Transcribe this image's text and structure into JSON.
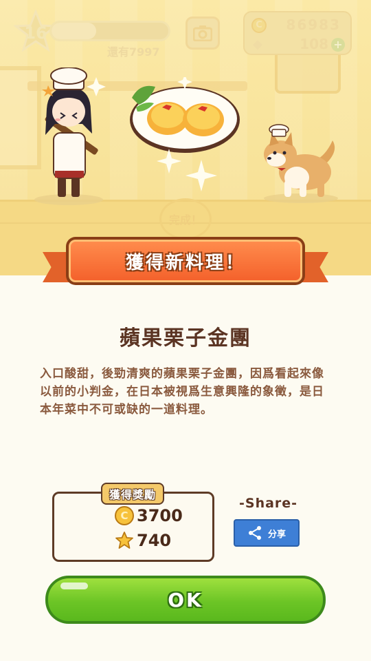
{
  "hud": {
    "level": "16",
    "exp_remaining_text": "還有7997",
    "exp_progress": 0.38,
    "coins": "86983",
    "gems": "108",
    "coin_symbol": "C",
    "plus_symbol": "+"
  },
  "scene": {
    "complete_stamp": "完成！"
  },
  "popup": {
    "banner_title": "獲得新料理！",
    "dish_name": "蘋果栗子金團",
    "dish_description": "入口酸甜，後勁清爽的蘋果栗子金團，因爲看起來像以前的小判金，在日本被視爲生意興隆的象徵，是日本年菜中不可或缺的一道料理。",
    "reward": {
      "label": "獲得獎勵",
      "coin_symbol": "C",
      "coins": "3700",
      "stars": "740"
    },
    "share": {
      "label": "-Share-",
      "button_label": "分享"
    },
    "ok_label": "OK"
  },
  "colors": {
    "banner": "#f4622c",
    "ok_green": "#6cc526",
    "share_blue": "#3e7fd6",
    "text_brown": "#5b3423"
  },
  "icons": {
    "level": "star-icon",
    "camera": "camera-icon",
    "coin": "coin-icon",
    "gem": "diamond-icon",
    "share": "share-icon"
  }
}
